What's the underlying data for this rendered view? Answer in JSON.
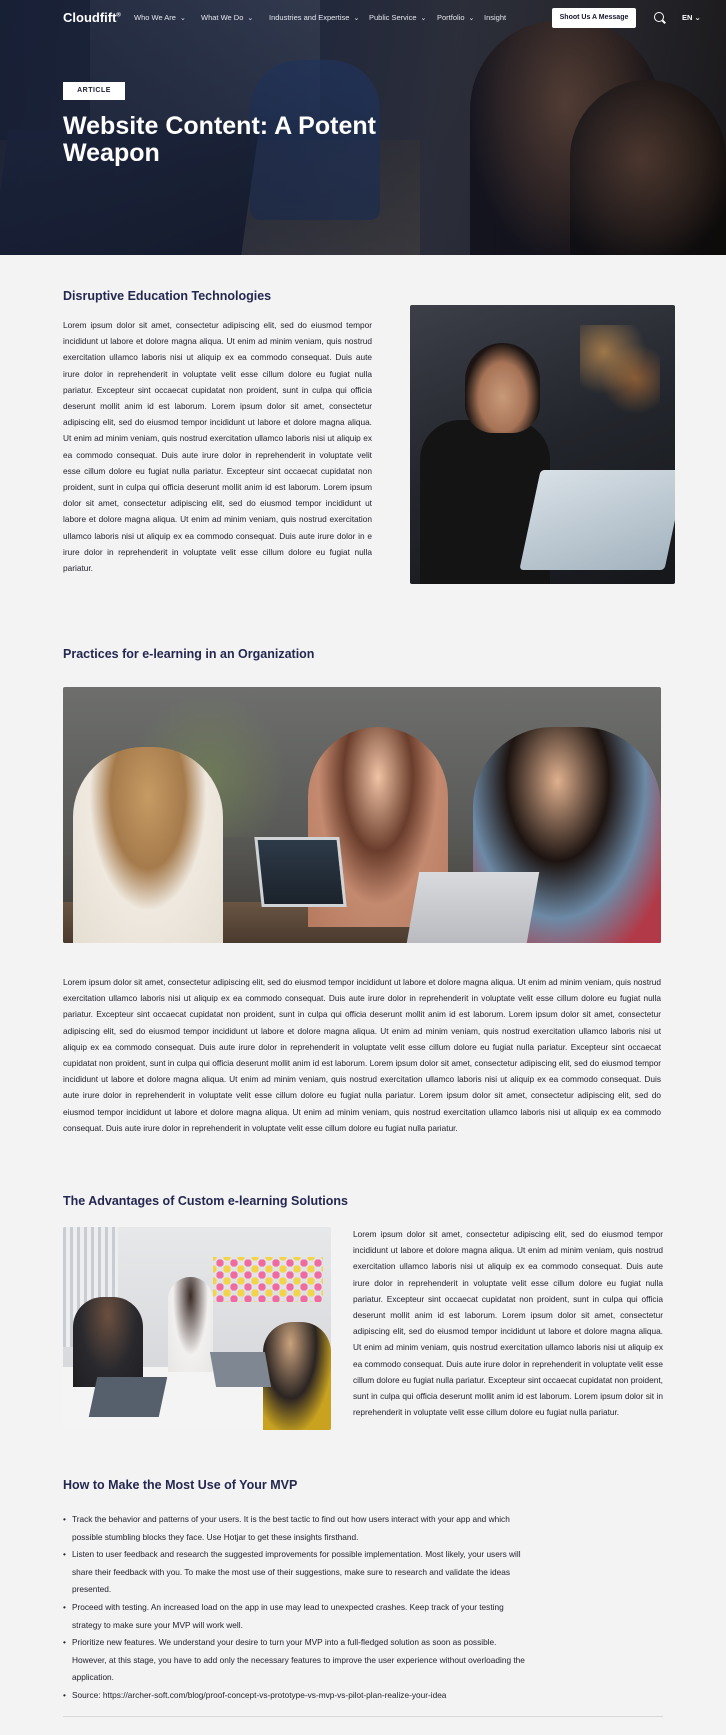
{
  "nav": {
    "logo": "Cloudfift",
    "items": [
      {
        "label": "Who We Are",
        "has_menu": true
      },
      {
        "label": "What We Do",
        "has_menu": true
      },
      {
        "label": "Industries and Expertise",
        "has_menu": true
      },
      {
        "label": "Public Service",
        "has_menu": true
      },
      {
        "label": "Portfolio",
        "has_menu": true
      },
      {
        "label": "Insight",
        "has_menu": false
      }
    ],
    "cta_label": "Shoot Us A Message",
    "search_icon": "search-icon",
    "language": "EN"
  },
  "hero": {
    "badge": "ARTICLE",
    "title": "Website Content: A Potent Weapon"
  },
  "sections": {
    "s1": {
      "heading": "Disruptive Education Technologies",
      "text": "Lorem ipsum dolor sit amet, consectetur adipiscing elit, sed do eiusmod tempor incididunt ut labore et dolore magna aliqua. Ut enim ad minim veniam, quis nostrud exercitation ullamco laboris nisi ut aliquip ex ea commodo consequat. Duis aute irure dolor in reprehenderit in voluptate velit esse cillum dolore eu fugiat nulla pariatur. Excepteur sint occaecat cupidatat non proident, sunt in culpa qui officia deserunt mollit anim id est laborum. Lorem ipsum dolor sit amet, consectetur adipiscing elit, sed do eiusmod tempor incididunt ut labore et dolore magna aliqua. Ut enim ad minim veniam, quis nostrud exercitation ullamco laboris nisi ut aliquip ex ea commodo consequat. Duis aute irure dolor in reprehenderit in voluptate velit esse cillum dolore eu fugiat nulla pariatur. Excepteur sint occaecat cupidatat non proident, sunt in culpa qui officia deserunt mollit anim id est laborum. Lorem ipsum dolor sit amet, consectetur adipiscing elit, sed do eiusmod tempor incididunt ut labore et dolore magna aliqua. Ut enim ad minim veniam, quis nostrud exercitation ullamco laboris nisi ut aliquip ex ea commodo consequat. Duis aute irure dolor in e irure dolor in reprehenderit in voluptate velit esse cillum dolore eu fugiat nulla pariatur."
    },
    "s2": {
      "heading": "Practices for e-learning in an Organization",
      "text": "Lorem ipsum dolor sit amet, consectetur adipiscing elit, sed do eiusmod tempor incididunt ut labore et dolore magna aliqua. Ut enim ad minim veniam, quis nostrud exercitation ullamco laboris nisi ut aliquip ex ea commodo consequat. Duis aute irure dolor in reprehenderit in voluptate velit esse cillum dolore eu fugiat nulla pariatur. Excepteur sint occaecat cupidatat non proident, sunt in culpa qui officia deserunt mollit anim id est laborum. Lorem ipsum dolor sit amet, consectetur adipiscing elit, sed do eiusmod tempor incididunt ut labore et dolore magna aliqua. Ut enim ad minim veniam, quis nostrud exercitation ullamco laboris nisi ut aliquip ex ea commodo consequat. Duis aute irure dolor in reprehenderit in voluptate velit esse cillum dolore eu fugiat nulla pariatur. Excepteur sint occaecat cupidatat non proident, sunt in culpa qui officia deserunt mollit anim id est laborum. Lorem ipsum dolor sit amet, consectetur adipiscing elit, sed do eiusmod tempor incididunt ut labore et dolore magna aliqua. Ut enim ad minim veniam, quis nostrud exercitation ullamco laboris nisi ut aliquip ex ea commodo consequat. Duis aute irure dolor in reprehenderit in voluptate velit esse cillum dolore eu fugiat nulla pariatur. Lorem ipsum dolor sit amet, consectetur adipiscing elit, sed do eiusmod tempor incididunt ut labore et dolore magna aliqua. Ut enim ad minim veniam, quis nostrud exercitation ullamco laboris nisi ut aliquip ex ea commodo consequat. Duis aute irure dolor in reprehenderit in voluptate velit esse cillum dolore eu fugiat nulla pariatur."
    },
    "s3": {
      "heading": "The Advantages of Custom e-learning Solutions",
      "text": "Lorem ipsum dolor sit amet, consectetur adipiscing elit, sed do eiusmod tempor incididunt ut labore et dolore magna aliqua. Ut enim ad minim veniam, quis nostrud exercitation ullamco laboris nisi ut aliquip ex ea commodo consequat. Duis aute irure dolor in reprehenderit in voluptate velit esse cillum dolore eu fugiat nulla pariatur. Excepteur sint occaecat cupidatat non proident, sunt in culpa qui officia deserunt mollit anim id est laborum. Lorem ipsum dolor sit amet, consectetur adipiscing elit, sed do eiusmod tempor incididunt ut labore et dolore magna aliqua. Ut enim ad minim veniam, quis nostrud exercitation ullamco laboris nisi ut aliquip ex ea commodo consequat. Duis aute irure dolor in reprehenderit in voluptate velit esse cillum dolore eu fugiat nulla pariatur. Excepteur sint occaecat cupidatat non proident, sunt in culpa qui officia deserunt mollit anim id est laborum. Lorem ipsum dolor sit in reprehenderit in voluptate velit esse cillum dolore eu fugiat nulla pariatur."
    },
    "s4": {
      "heading": "How to Make the Most Use of Your MVP",
      "bullets": [
        "Track the behavior and patterns of your users. It is the best tactic to find out how users interact with your app and which possible stumbling blocks they face. Use Hotjar to get these insights firsthand.",
        "Listen to user feedback and research the suggested improvements for possible implementation. Most likely, your users will share their feedback with you. To make the most use of their suggestions, make sure to research and validate the ideas presented.",
        "Proceed with testing. An increased load on the app in use may lead to unexpected crashes. Keep track of your testing strategy to make sure your MVP will work well.",
        "Prioritize new features. We understand your desire to turn your MVP into a full-fledged solution as soon as possible. However, at this stage, you have to add only the necessary features to improve the user experience without overloading the application.",
        "Source: https://archer-soft.com/blog/proof-concept-vs-prototype-vs-mvp-vs-pilot-plan-realize-your-idea"
      ]
    }
  }
}
